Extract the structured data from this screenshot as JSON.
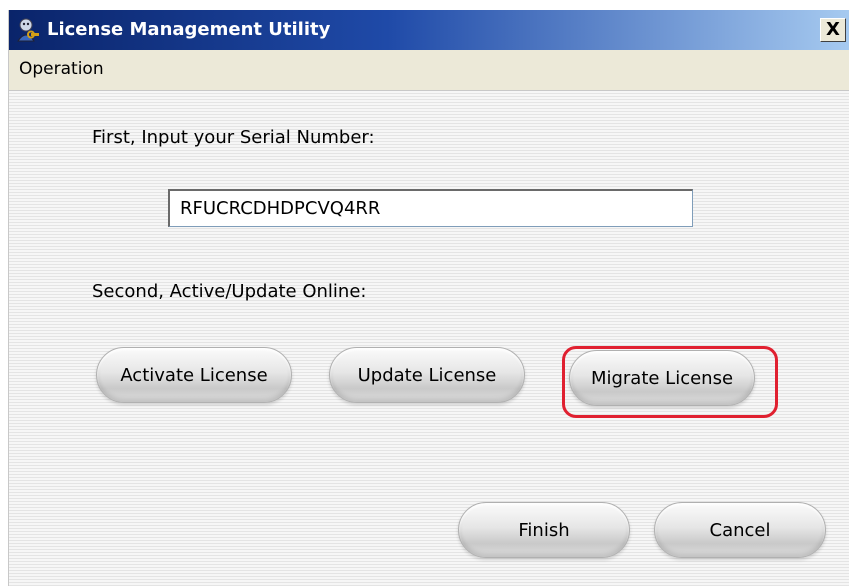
{
  "window": {
    "title": "License Management Utility",
    "close_label": "X"
  },
  "menu": {
    "items": [
      {
        "label": "Operation"
      }
    ]
  },
  "form": {
    "serial_prompt": "First, Input your Serial Number:",
    "serial_value": "RFUCRCDHDPCVQ4RR",
    "online_prompt": "Second, Active/Update Online:"
  },
  "buttons": {
    "activate": "Activate License",
    "update": "Update License",
    "migrate": "Migrate License",
    "finish": "Finish",
    "cancel": "Cancel"
  },
  "colors": {
    "highlight": "#e02030",
    "title_bar_start": "#0a246a",
    "title_bar_end": "#a6caf0"
  },
  "icons": {
    "app": "user-key-icon",
    "close": "close-icon"
  }
}
